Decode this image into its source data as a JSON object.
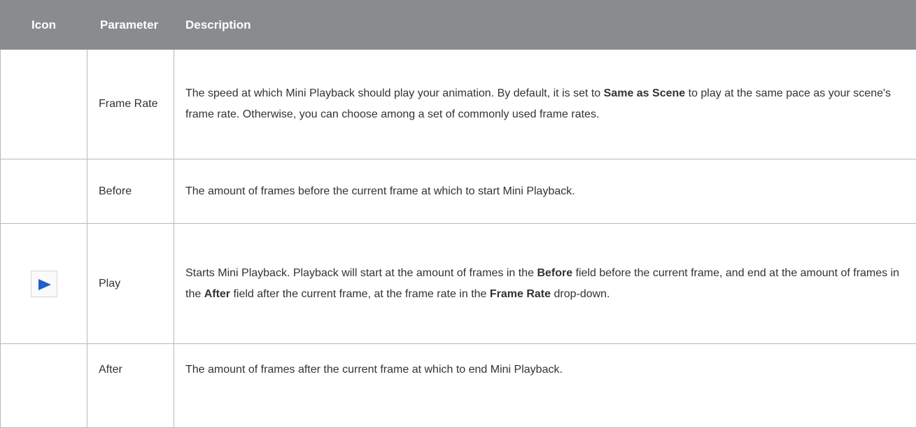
{
  "headers": {
    "icon": "Icon",
    "parameter": "Parameter",
    "description": "Description"
  },
  "rows": [
    {
      "parameter": "Frame Rate",
      "desc": [
        {
          "t": "The speed at which Mini Playback should play your animation. By default, it is set to "
        },
        {
          "t": "Same as Scene",
          "b": true
        },
        {
          "t": " to play at the same pace as your scene's frame rate. Otherwise, you can choose among a set of commonly used frame rates."
        }
      ]
    },
    {
      "parameter": "Before",
      "desc": [
        {
          "t": "The amount of frames before the current frame at which to start Mini Playback."
        }
      ]
    },
    {
      "parameter": "Play",
      "icon": "play-icon",
      "desc": [
        {
          "t": "Starts Mini Playback. Playback will start at the amount of frames in the "
        },
        {
          "t": "Before",
          "b": true
        },
        {
          "t": " field before the current frame, and end at the amount of frames in the "
        },
        {
          "t": "After",
          "b": true
        },
        {
          "t": " field after the current frame, at the frame rate in the "
        },
        {
          "t": "Frame Rate",
          "b": true
        },
        {
          "t": " drop-down."
        }
      ]
    },
    {
      "parameter": "After",
      "desc": [
        {
          "t": "The amount of frames after the current frame at which to end Mini Playback."
        }
      ]
    }
  ],
  "colors": {
    "header_bg": "#8a8b8d",
    "play_icon": "#1f5fc8"
  }
}
